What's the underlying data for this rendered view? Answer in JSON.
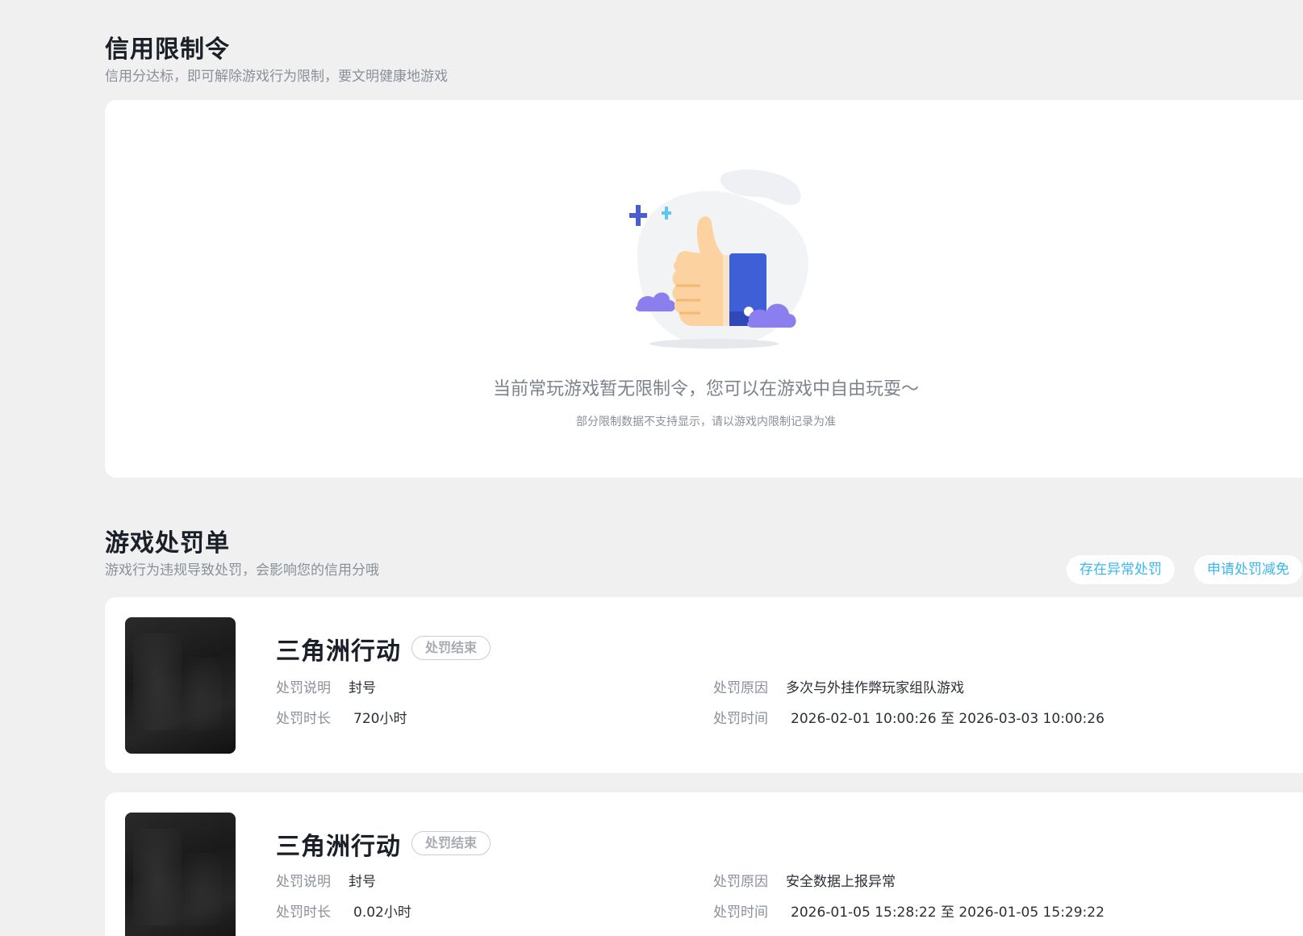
{
  "credit": {
    "title": "信用限制令",
    "subtitle": "信用分达标，即可解除游戏行为限制，要文明健康地游戏",
    "empty_main": "当前常玩游戏暂无限制令，您可以在游戏中自由玩耍～",
    "empty_sub": "部分限制数据不支持显示，请以游戏内限制记录为准"
  },
  "penalty": {
    "title": "游戏处罚单",
    "subtitle": "游戏行为违规导致处罚，会影响您的信用分哦",
    "buttons": {
      "abnormal": "存在异常处罚",
      "apply": "申请处罚减免"
    },
    "labels": {
      "desc": "处罚说明",
      "duration": "处罚时长",
      "reason": "处罚原因",
      "time": "处罚时间"
    },
    "items": [
      {
        "game": "三角洲行动",
        "status": "处罚结束",
        "desc": "封号",
        "duration": "720小时",
        "reason": "多次与外挂作弊玩家组队游戏",
        "time": "2026-02-01 10:00:26 至 2026-03-03 10:00:26"
      },
      {
        "game": "三角洲行动",
        "status": "处罚结束",
        "desc": "封号",
        "duration": "0.02小时",
        "reason": "安全数据上报异常",
        "time": "2026-01-05 15:28:22 至 2026-01-05 15:29:22"
      }
    ]
  },
  "colors": {
    "background": "#f0f0f0",
    "card": "#ffffff",
    "accent": "#3bb6f0",
    "thumb_blue": "#3f5fd6",
    "cloud_purple": "#8b7ff0",
    "hand": "#fcd3a0"
  },
  "icons": {
    "illustration": "thumbs-up-illustration"
  }
}
